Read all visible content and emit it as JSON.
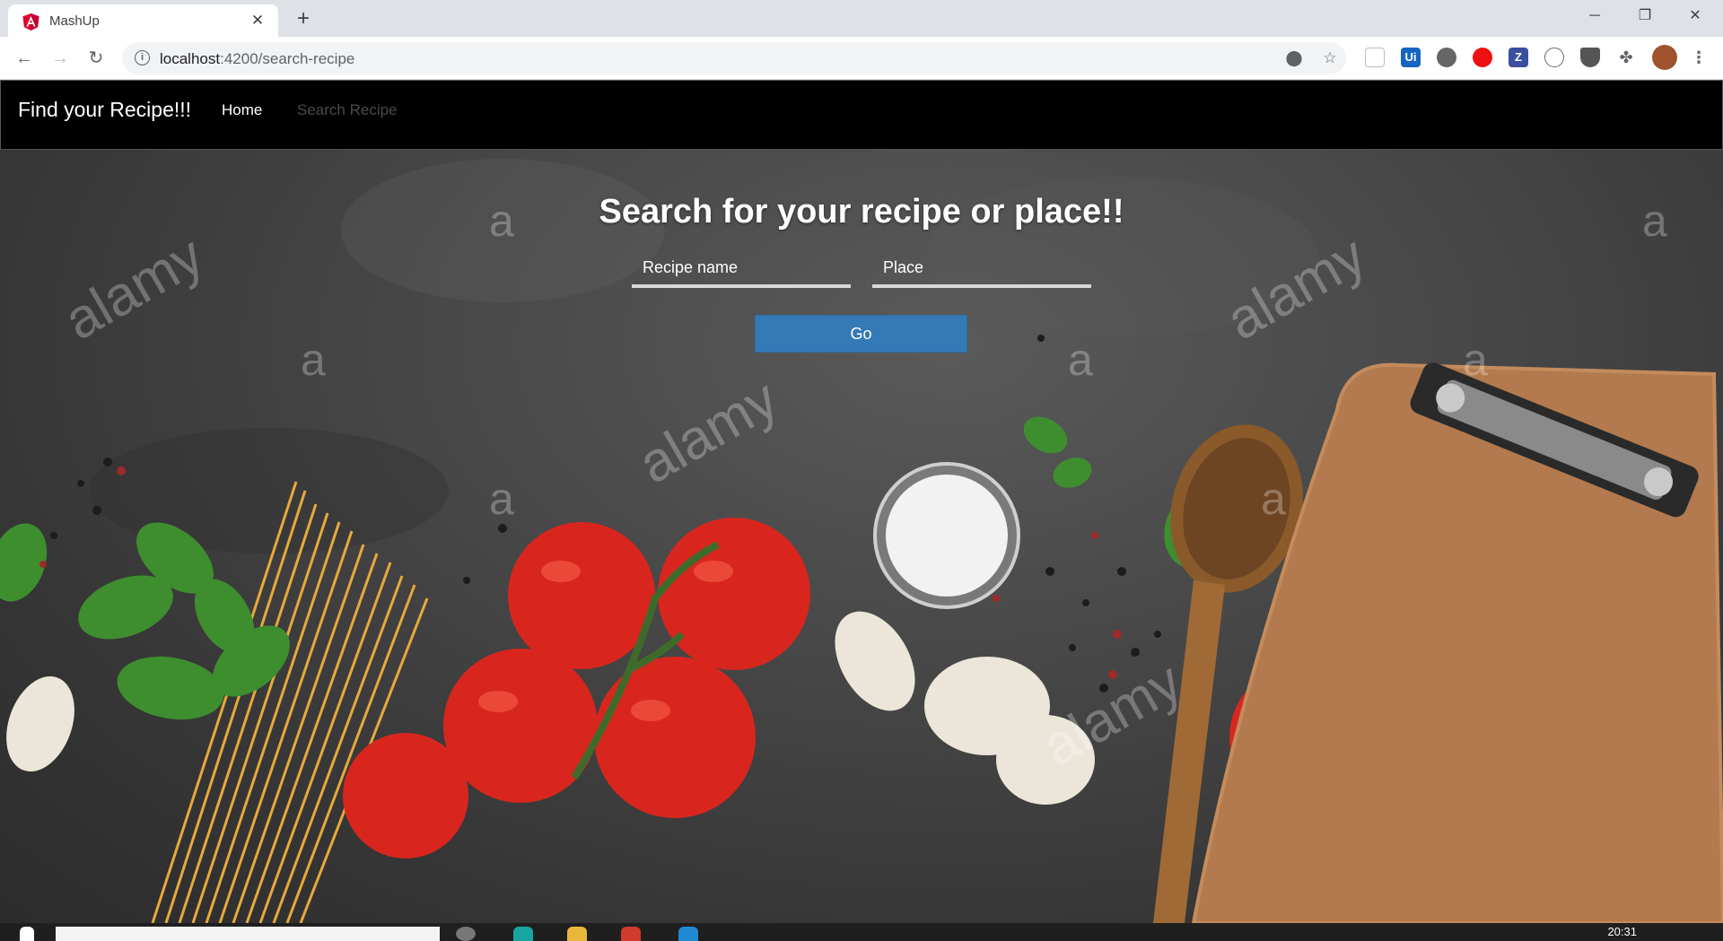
{
  "browser": {
    "tab_title": "MashUp",
    "url_host": "localhost",
    "url_path": ":4200/search-recipe"
  },
  "app": {
    "brand": "Find your Recipe!!!",
    "nav": [
      "Home",
      "Search Recipe"
    ]
  },
  "hero": {
    "title": "Search for your recipe or place!!",
    "recipe_placeholder": "Recipe name",
    "place_placeholder": "Place",
    "go_label": "Go",
    "watermark_text": "alamy",
    "watermark_letter": "a"
  },
  "taskbar": {
    "clock": "20:31"
  },
  "icons": {
    "tab_favicon": "angular-logo-icon",
    "tab_close": "close-icon",
    "new_tab": "plus-icon",
    "back": "arrow-left-icon",
    "forward": "arrow-right-icon",
    "reload": "reload-icon",
    "site_info": "info-icon",
    "location": "location-pin-icon",
    "bookmark": "star-icon",
    "extensions": "puzzle-icon",
    "menu": "kebab-menu-icon"
  },
  "colors": {
    "navbar_bg": "#000000",
    "go_button": "#337ab7",
    "chrome_tabstrip": "#dee1e6"
  }
}
